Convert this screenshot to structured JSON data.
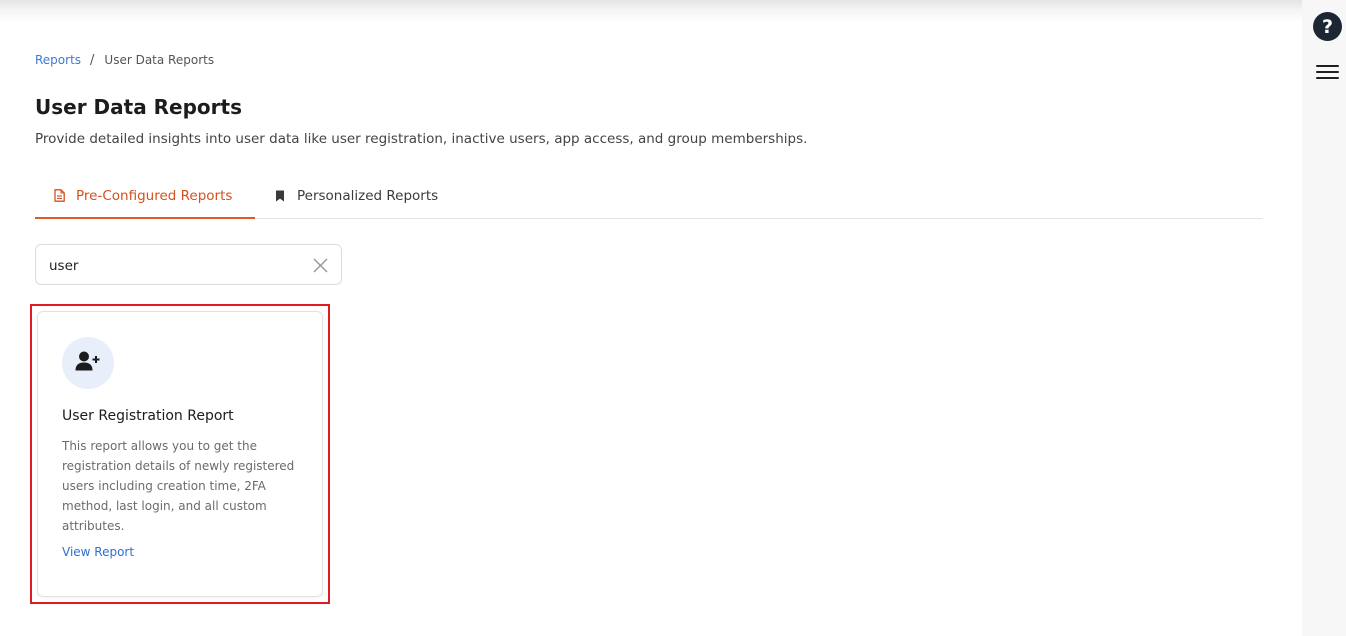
{
  "breadcrumb": {
    "root": "Reports",
    "separator": "/",
    "current": "User Data Reports"
  },
  "page": {
    "title": "User Data Reports",
    "description": "Provide detailed insights into user data like user registration, inactive users, app access, and group memberships."
  },
  "tabs": [
    {
      "label": "Pre-Configured Reports",
      "icon": "document-icon",
      "active": true
    },
    {
      "label": "Personalized Reports",
      "icon": "bookmark-icon",
      "active": false
    }
  ],
  "search": {
    "value": "user",
    "clear_icon": "close-icon"
  },
  "cards": [
    {
      "icon": "user-plus-icon",
      "title": "User Registration Report",
      "description": "This report allows you to get the registration details of newly registered users including creation time, 2FA method, last login, and all custom attributes.",
      "link_label": "View Report"
    }
  ],
  "rail": {
    "help_label": "?",
    "help_icon": "question-icon",
    "menu_icon": "hamburger-menu-icon"
  },
  "colors": {
    "accent": "#d4501e",
    "link": "#3c7ad6",
    "highlight": "#e01b22",
    "icon_bg": "#e8eefa"
  }
}
